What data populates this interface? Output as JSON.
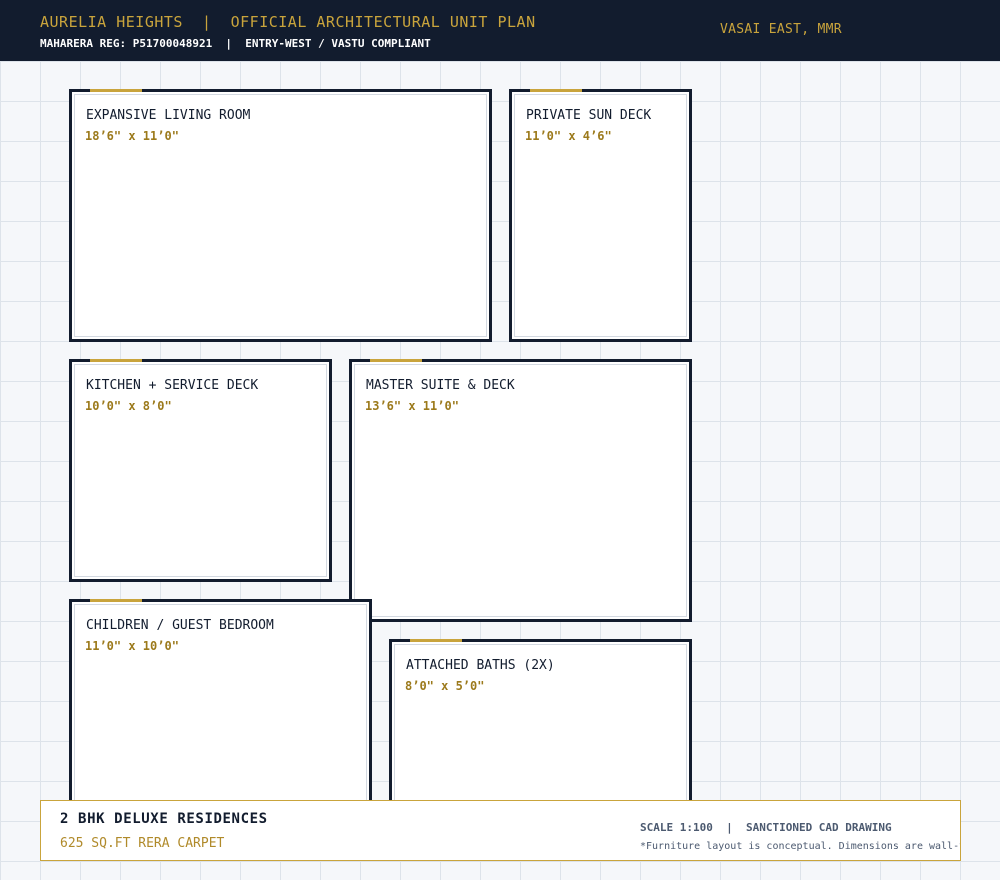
{
  "header": {
    "title": "AURELIA HEIGHTS  |  OFFICIAL ARCHITECTURAL UNIT PLAN",
    "subtitle": "MAHARERA REG: P51700048921  |  ENTRY-WEST / VASTU COMPLIANT",
    "location": "VASAI EAST, MMR"
  },
  "rooms": [
    {
      "name": "EXPANSIVE LIVING ROOM",
      "dimensions": "18’6\" x 11’0\""
    },
    {
      "name": "PRIVATE SUN DECK",
      "dimensions": "11’0\" x 4’6\""
    },
    {
      "name": "KITCHEN + SERVICE DECK",
      "dimensions": "10’0\" x 8’0\""
    },
    {
      "name": "MASTER SUITE & DECK",
      "dimensions": "13’6\" x 11’0\""
    },
    {
      "name": "CHILDREN / GUEST BEDROOM",
      "dimensions": "11’0\" x 10’0\""
    },
    {
      "name": "ATTACHED BATHS (2X)",
      "dimensions": "8’0\" x 5’0\""
    }
  ],
  "footer": {
    "title": "2 BHK DELUXE RESIDENCES",
    "area": "625 SQ.FT RERA CARPET",
    "scale": "SCALE 1:100  |  SANCTIONED CAD DRAWING",
    "note": "*Furniture layout is conceptual. Dimensions are wall-to-wall"
  },
  "colors": {
    "navy": "#121c2e",
    "gold": "#c9a43c",
    "dimension_gold": "#9c7a1c",
    "grid": "#dde3ea",
    "background": "#f5f7fa"
  }
}
